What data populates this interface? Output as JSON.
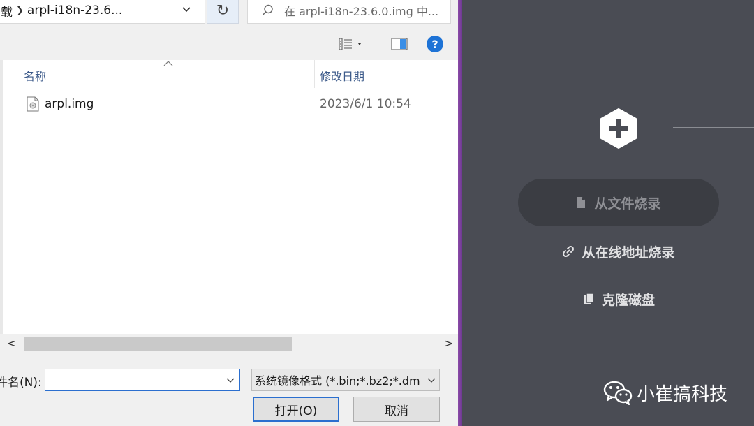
{
  "dialog": {
    "address_prev": "载",
    "address_current": "arpl-i18n-23.6...",
    "search_placeholder": "在 arpl-i18n-23.6.0.img 中...",
    "columns": {
      "name": "名称",
      "date": "修改日期"
    },
    "files": [
      {
        "name": "arpl.img",
        "date": "2023/6/1 10:54",
        "icon": "disk-image-file-icon"
      }
    ],
    "filename_label": "件名(N):",
    "filename_value": "",
    "filter_value": "系统镜像格式 (*.bin;*.bz2;*.dm",
    "open_label": "打开(O)",
    "cancel_label": "取消"
  },
  "app": {
    "actions": {
      "file": "从文件烧录",
      "online": "从在线地址烧录",
      "clone": "克隆磁盘"
    },
    "colors": {
      "background": "#4a4c54",
      "primary_button_bg": "#3b3d43",
      "accent_divider": "#8b4aa8"
    }
  },
  "watermark": {
    "text": "小崔搞科技",
    "icon": "wechat-icon"
  }
}
